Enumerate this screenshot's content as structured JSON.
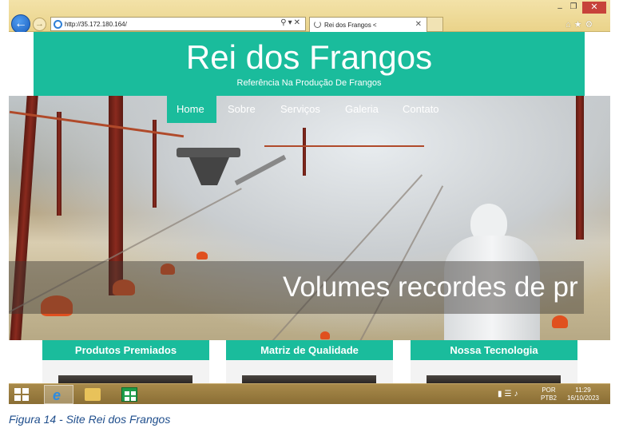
{
  "browser": {
    "url": "http://35.172.180.164/",
    "tab_title": "Rei dos Frangos <"
  },
  "site": {
    "title": "Rei dos Frangos",
    "subtitle": "Referência Na Produção De Frangos",
    "nav": [
      {
        "label": "Home",
        "active": true
      },
      {
        "label": "Sobre",
        "active": false
      },
      {
        "label": "Serviços",
        "active": false
      },
      {
        "label": "Galeria",
        "active": false
      },
      {
        "label": "Contato",
        "active": false
      }
    ],
    "slide_caption": "Volumes recordes de pr",
    "cards": [
      {
        "title": "Produtos Premiados"
      },
      {
        "title": "Matriz de Qualidade"
      },
      {
        "title": "Nossa Tecnologia"
      }
    ],
    "accent_color": "#1abc9c"
  },
  "taskbar": {
    "language_line1": "POR",
    "language_line2": "PTB2",
    "time": "11:29",
    "date": "16/10/2023"
  },
  "figure_caption": "Figura 14 - Site Rei dos Frangos"
}
